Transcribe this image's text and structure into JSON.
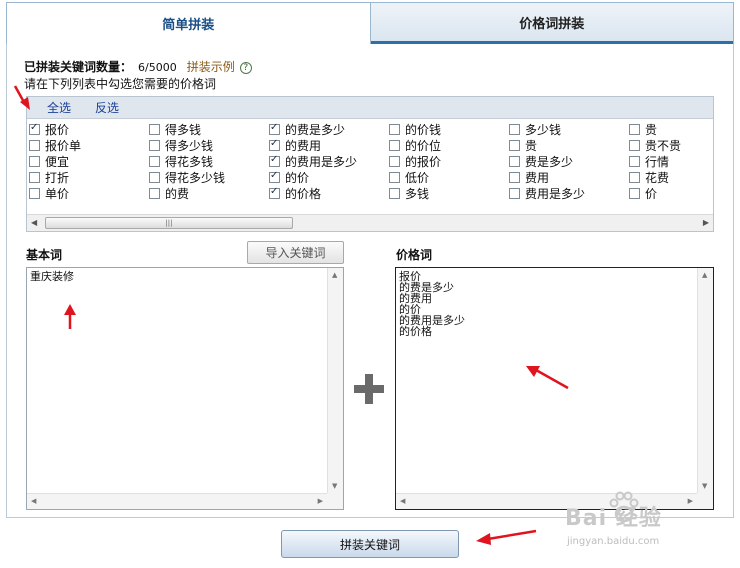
{
  "tabs": [
    {
      "label": "简单拼装",
      "active": true
    },
    {
      "label": "价格词拼装",
      "active": false
    }
  ],
  "status": {
    "count_label": "已拼装关键词数量：",
    "count_value": "6/5000",
    "example_link": "拼装示例",
    "help_icon": "question-mark-icon"
  },
  "instruction": "请在下列列表中勾选您需要的价格词",
  "list": {
    "select_all": "全选",
    "invert": "反选",
    "columns": [
      [
        {
          "label": "报价",
          "checked": true
        },
        {
          "label": "报价单",
          "checked": false
        },
        {
          "label": "便宜",
          "checked": false
        },
        {
          "label": "打折",
          "checked": false
        },
        {
          "label": "单价",
          "checked": false
        }
      ],
      [
        {
          "label": "得多钱",
          "checked": false
        },
        {
          "label": "得多少钱",
          "checked": false
        },
        {
          "label": "得花多钱",
          "checked": false
        },
        {
          "label": "得花多少钱",
          "checked": false
        },
        {
          "label": "的费",
          "checked": false
        }
      ],
      [
        {
          "label": "的费是多少",
          "checked": true
        },
        {
          "label": "的费用",
          "checked": true
        },
        {
          "label": "的费用是多少",
          "checked": true
        },
        {
          "label": "的价",
          "checked": true
        },
        {
          "label": "的价格",
          "checked": true
        }
      ],
      [
        {
          "label": "的价钱",
          "checked": false
        },
        {
          "label": "的价位",
          "checked": false
        },
        {
          "label": "的报价",
          "checked": false
        },
        {
          "label": "低价",
          "checked": false
        },
        {
          "label": "多钱",
          "checked": false
        }
      ],
      [
        {
          "label": "多少钱",
          "checked": false
        },
        {
          "label": "贵",
          "checked": false
        },
        {
          "label": "费是多少",
          "checked": false
        },
        {
          "label": "费用",
          "checked": false
        },
        {
          "label": "费用是多少",
          "checked": false
        }
      ],
      [
        {
          "label": "贵",
          "checked": false
        },
        {
          "label": "贵不贵",
          "checked": false
        },
        {
          "label": "行情",
          "checked": false
        },
        {
          "label": "花费",
          "checked": false
        },
        {
          "label": "价",
          "checked": false
        }
      ]
    ]
  },
  "base_words": {
    "label": "基本词",
    "import_button": "导入关键词",
    "content": "重庆装修"
  },
  "price_words": {
    "label": "价格词",
    "content": "报价\n的费是多少\n的费用\n的价\n的费用是多少\n的价格"
  },
  "submit_button": "拼装关键词",
  "watermark": {
    "brand": "Bai  经验",
    "url": "jingyan.baidu.com"
  },
  "colors": {
    "annotation_arrow": "#e0141e",
    "tab_accent": "#2d6fa8"
  }
}
